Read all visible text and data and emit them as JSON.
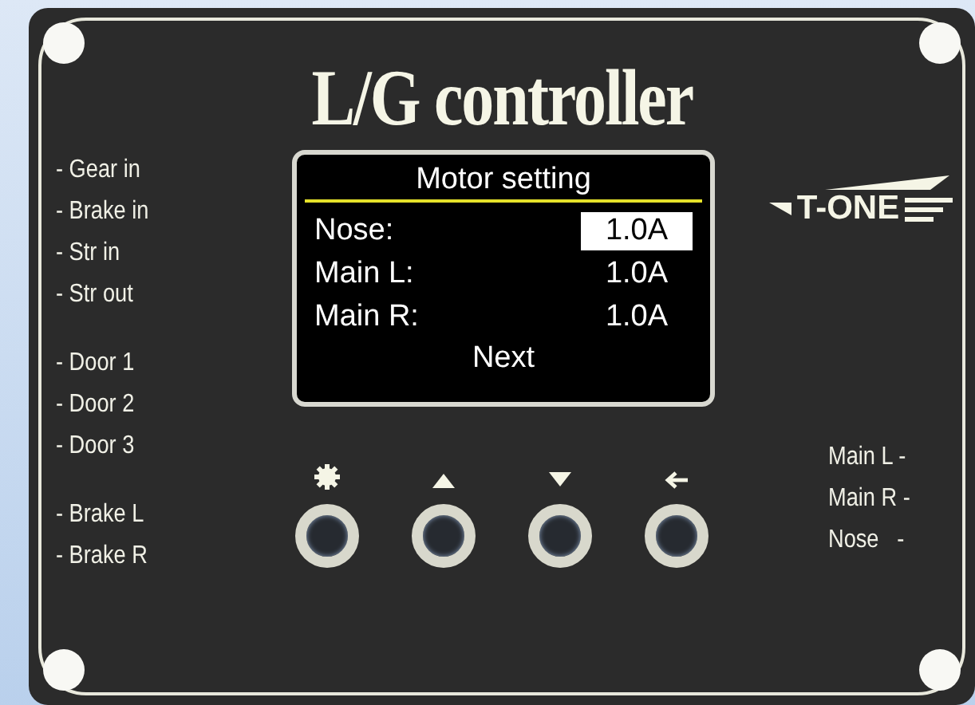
{
  "title": "L/G controller",
  "brand": "T-ONE",
  "display": {
    "title": "Motor setting",
    "rows": [
      {
        "label": "Nose:",
        "value": "1.0A",
        "selected": true
      },
      {
        "label": "Main L:",
        "value": "1.0A",
        "selected": false
      },
      {
        "label": "Main R:",
        "value": "1.0A",
        "selected": false
      }
    ],
    "footer": "Next"
  },
  "left_label_groups": [
    [
      "- Gear in",
      "- Brake in",
      "- Str in",
      "- Str out"
    ],
    [
      "- Door 1",
      "- Door 2",
      "- Door 3"
    ],
    [
      "- Brake L",
      "- Brake R"
    ]
  ],
  "buttons": [
    {
      "kind": "settings"
    },
    {
      "kind": "up"
    },
    {
      "kind": "down"
    },
    {
      "kind": "back"
    }
  ],
  "right_labels": [
    "Main L -",
    "Main R -",
    "Nose   -"
  ]
}
